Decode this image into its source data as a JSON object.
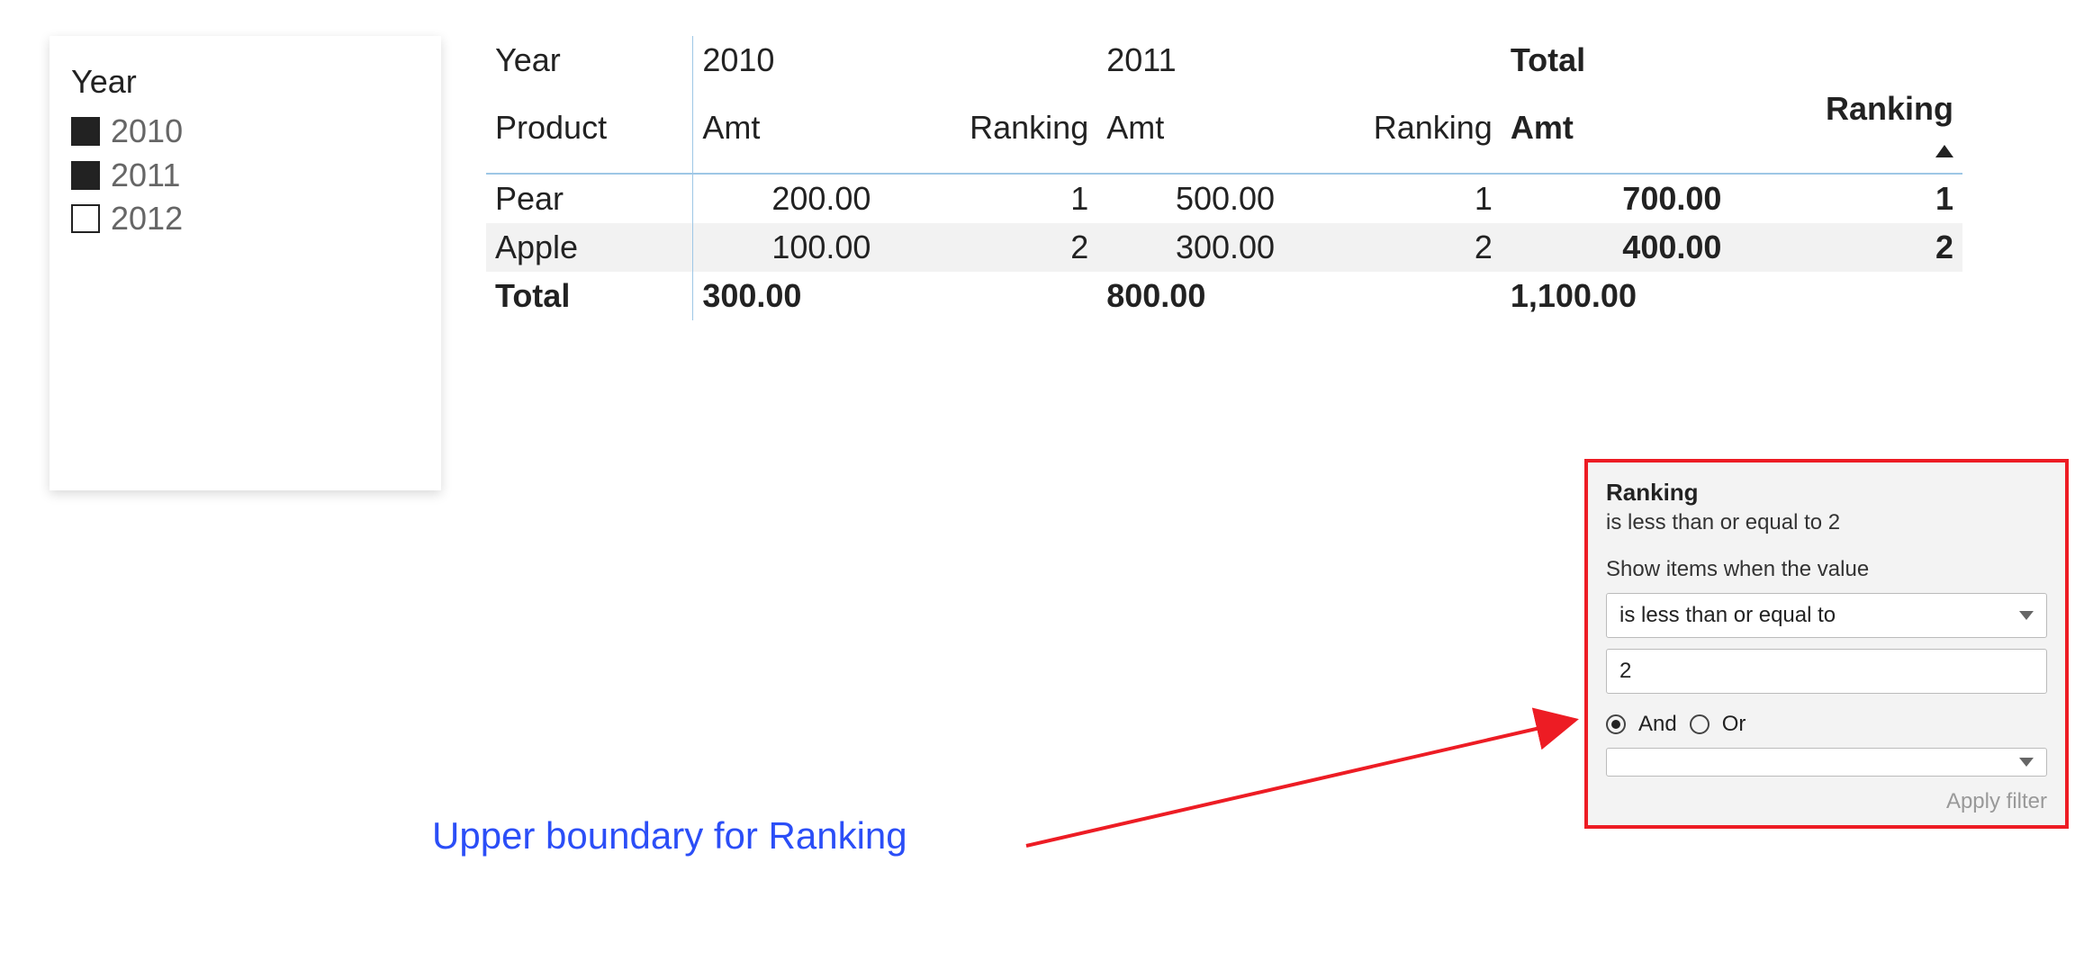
{
  "slicer": {
    "title": "Year",
    "items": [
      {
        "label": "2010",
        "checked": true
      },
      {
        "label": "2011",
        "checked": true
      },
      {
        "label": "2012",
        "checked": false
      }
    ]
  },
  "matrix": {
    "row_header_top": "Year",
    "row_header_bottom": "Product",
    "year_groups": [
      "2010",
      "2011"
    ],
    "total_group": "Total",
    "measures": [
      "Amt",
      "Ranking"
    ],
    "rows": [
      {
        "product": "Pear",
        "y2010_amt": "200.00",
        "y2010_rank": "1",
        "y2011_amt": "500.00",
        "y2011_rank": "1",
        "total_amt": "700.00",
        "total_rank": "1"
      },
      {
        "product": "Apple",
        "y2010_amt": "100.00",
        "y2010_rank": "2",
        "y2011_amt": "300.00",
        "y2011_rank": "2",
        "total_amt": "400.00",
        "total_rank": "2"
      }
    ],
    "total_row": {
      "label": "Total",
      "y2010_amt": "300.00",
      "y2011_amt": "800.00",
      "total_amt": "1,100.00"
    }
  },
  "filter": {
    "title": "Ranking",
    "summary": "is less than or equal to 2",
    "prompt": "Show items when the value",
    "operator1": "is less than or equal to",
    "value1": "2",
    "logic_and": "And",
    "logic_or": "Or",
    "operator2": "",
    "apply": "Apply filter"
  },
  "annotation": {
    "text": "Upper boundary for Ranking"
  }
}
